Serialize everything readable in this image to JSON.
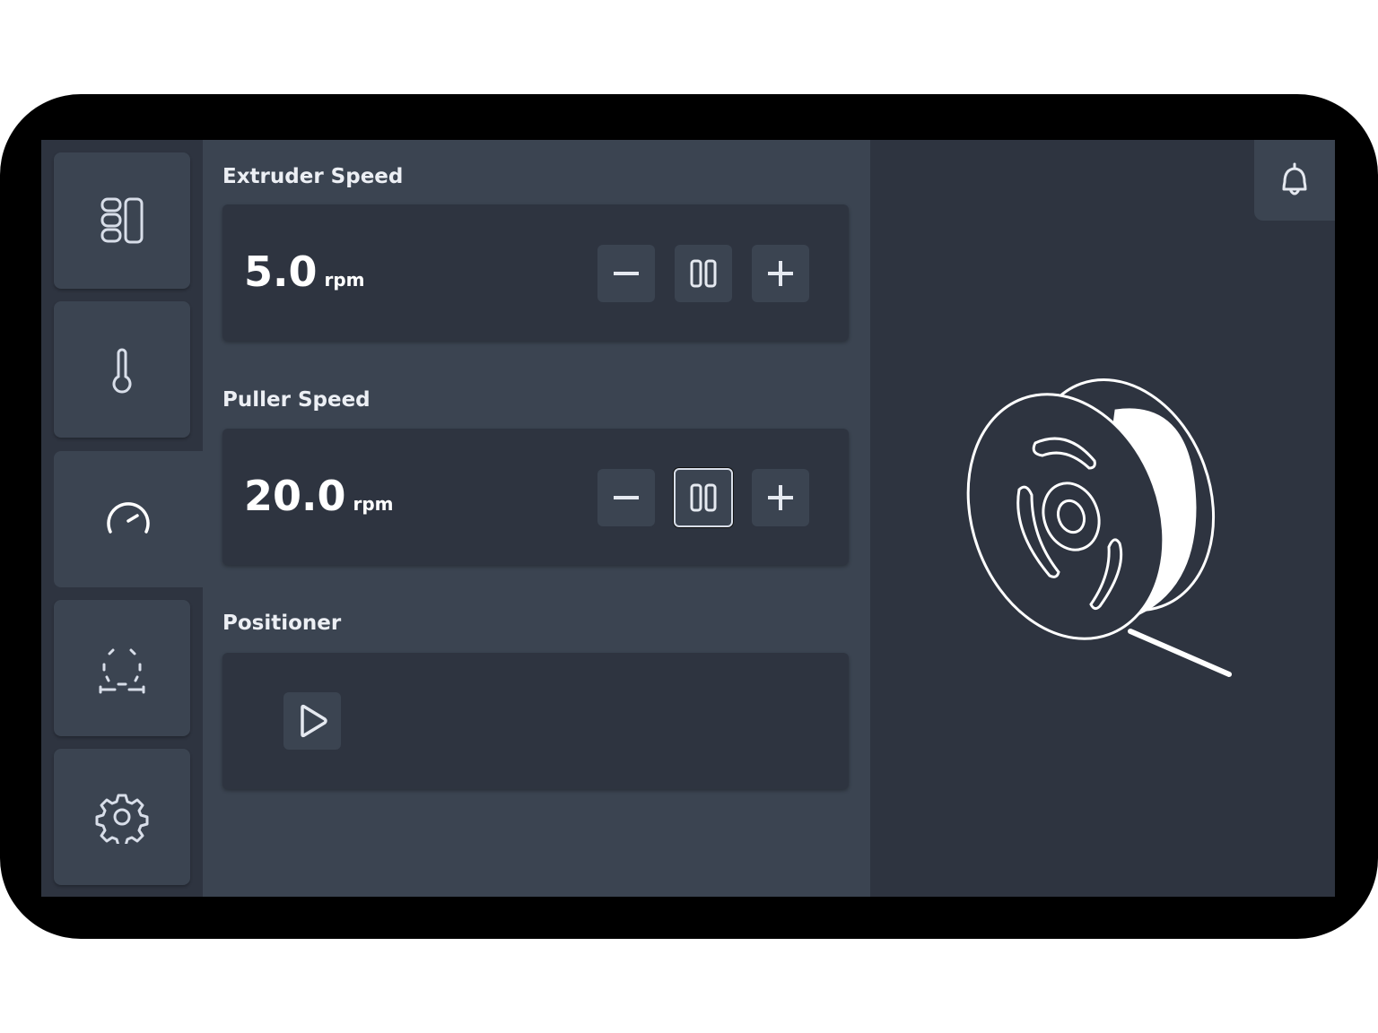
{
  "sidebar": {
    "items": [
      {
        "icon": "dashboard-layout-icon"
      },
      {
        "icon": "thermometer-icon"
      },
      {
        "icon": "speedometer-icon",
        "active": true
      },
      {
        "icon": "positioner-icon"
      },
      {
        "icon": "gear-icon"
      }
    ]
  },
  "extruder": {
    "title": "Extruder Speed",
    "value": "5.0",
    "unit": "rpm",
    "controls": [
      "minus-icon",
      "pause-icon",
      "plus-icon"
    ]
  },
  "puller": {
    "title": "Puller Speed",
    "value": "20.0",
    "unit": "rpm",
    "controls": [
      "minus-icon",
      "pause-icon",
      "plus-icon"
    ]
  },
  "positioner": {
    "title": "Positioner",
    "controls": [
      "play-icon"
    ]
  },
  "header": {
    "notification_icon": "bell-icon"
  },
  "illustration": {
    "icon": "filament-spool-illustration"
  },
  "colors": {
    "background": "#2e3440",
    "panel": "#3b4451",
    "text": "#eceff4"
  }
}
